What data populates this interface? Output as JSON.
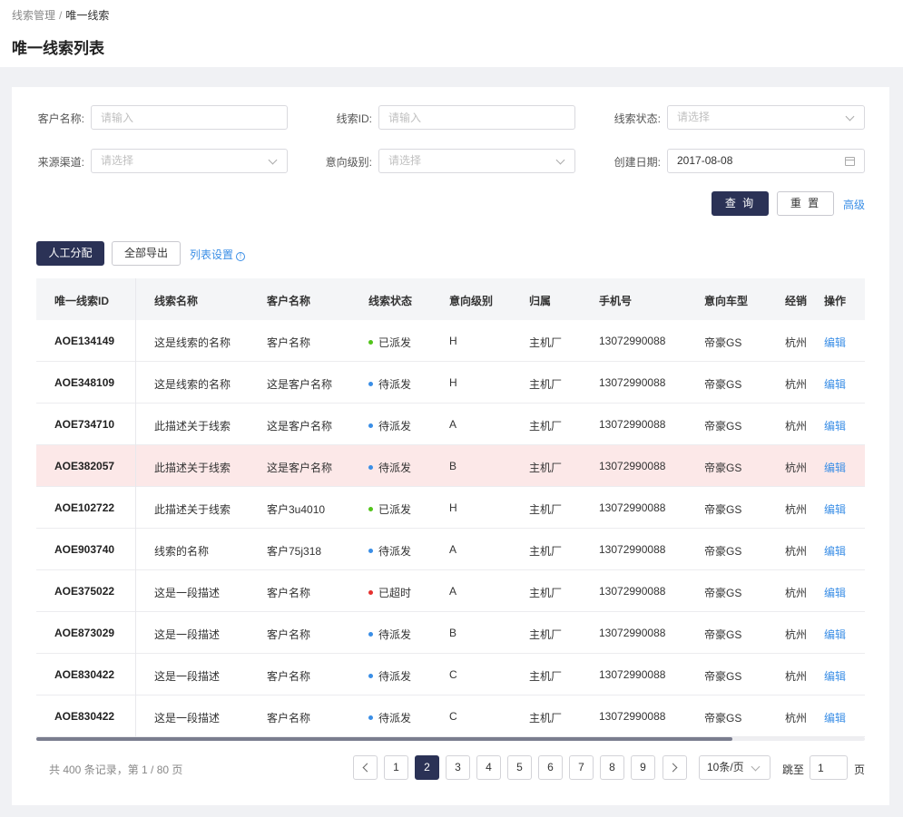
{
  "breadcrumb": {
    "parent": "线索管理",
    "separator": "/",
    "current": "唯一线索"
  },
  "page_title": "唯一线索列表",
  "filters": {
    "customer_name": {
      "label": "客户名称:",
      "placeholder": "请输入"
    },
    "lead_id": {
      "label": "线索ID:",
      "placeholder": "请输入"
    },
    "lead_status": {
      "label": "线索状态:",
      "placeholder": "请选择"
    },
    "source_channel": {
      "label": "来源渠道:",
      "placeholder": "请选择"
    },
    "intent_level": {
      "label": "意向级别:",
      "placeholder": "请选择"
    },
    "created_date": {
      "label": "创建日期:",
      "value": "2017-08-08"
    }
  },
  "actions": {
    "query": "查 询",
    "reset": "重 置",
    "advanced": "高级"
  },
  "toolbar": {
    "manual_assign": "人工分配",
    "export_all": "全部导出",
    "list_settings": "列表设置",
    "info_glyph": "!"
  },
  "table": {
    "columns": [
      "唯一线索ID",
      "线索名称",
      "客户名称",
      "线索状态",
      "意向级别",
      "归属",
      "手机号",
      "意向车型",
      "经销",
      "操作"
    ],
    "rows": [
      {
        "id": "AOE134149",
        "name": "这是线索的名称",
        "customer": "客户名称",
        "status": "已派发",
        "status_color": "#52c41a",
        "level": "H",
        "owner": "主机厂",
        "phone": "13072990088",
        "model": "帝豪GS",
        "dealer": "杭州",
        "action": "编辑"
      },
      {
        "id": "AOE348109",
        "name": "这是线索的名称",
        "customer": "这是客户名称",
        "status": "待派发",
        "status_color": "#3a8ee6",
        "level": "H",
        "owner": "主机厂",
        "phone": "13072990088",
        "model": "帝豪GS",
        "dealer": "杭州",
        "action": "编辑"
      },
      {
        "id": "AOE734710",
        "name": "此描述关于线索",
        "customer": "这是客户名称",
        "status": "待派发",
        "status_color": "#3a8ee6",
        "level": "A",
        "owner": "主机厂",
        "phone": "13072990088",
        "model": "帝豪GS",
        "dealer": "杭州",
        "action": "编辑"
      },
      {
        "id": "AOE382057",
        "name": "此描述关于线索",
        "customer": "这是客户名称",
        "status": "待派发",
        "status_color": "#3a8ee6",
        "level": "B",
        "owner": "主机厂",
        "phone": "13072990088",
        "model": "帝豪GS",
        "dealer": "杭州",
        "action": "编辑",
        "highlighted": true
      },
      {
        "id": "AOE102722",
        "name": "此描述关于线索",
        "customer": "客户3u4010",
        "status": "已派发",
        "status_color": "#52c41a",
        "level": "H",
        "owner": "主机厂",
        "phone": "13072990088",
        "model": "帝豪GS",
        "dealer": "杭州",
        "action": "编辑"
      },
      {
        "id": "AOE903740",
        "name": "线索的名称",
        "customer": "客户75j318",
        "status": "待派发",
        "status_color": "#3a8ee6",
        "level": "A",
        "owner": "主机厂",
        "phone": "13072990088",
        "model": "帝豪GS",
        "dealer": "杭州",
        "action": "编辑"
      },
      {
        "id": "AOE375022",
        "name": "这是一段描述",
        "customer": "客户名称",
        "status": "已超时",
        "status_color": "#e5312f",
        "level": "A",
        "owner": "主机厂",
        "phone": "13072990088",
        "model": "帝豪GS",
        "dealer": "杭州",
        "action": "编辑"
      },
      {
        "id": "AOE873029",
        "name": "这是一段描述",
        "customer": "客户名称",
        "status": "待派发",
        "status_color": "#3a8ee6",
        "level": "B",
        "owner": "主机厂",
        "phone": "13072990088",
        "model": "帝豪GS",
        "dealer": "杭州",
        "action": "编辑"
      },
      {
        "id": "AOE830422",
        "name": "这是一段描述",
        "customer": "客户名称",
        "status": "待派发",
        "status_color": "#3a8ee6",
        "level": "C",
        "owner": "主机厂",
        "phone": "13072990088",
        "model": "帝豪GS",
        "dealer": "杭州",
        "action": "编辑"
      },
      {
        "id": "AOE830422",
        "name": "这是一段描述",
        "customer": "客户名称",
        "status": "待派发",
        "status_color": "#3a8ee6",
        "level": "C",
        "owner": "主机厂",
        "phone": "13072990088",
        "model": "帝豪GS",
        "dealer": "杭州",
        "action": "编辑"
      }
    ]
  },
  "horizontal_scroll_fraction": 0.84,
  "pagination": {
    "summary": "共 400 条记录，第 1 / 80 页",
    "pages": [
      "1",
      "2",
      "3",
      "4",
      "5",
      "6",
      "7",
      "8",
      "9"
    ],
    "current_page": "2",
    "page_size": "10条/页",
    "jump_label": "跳至",
    "jump_value": "1",
    "page_unit": "页"
  },
  "colors": {
    "primary": "#2b3256",
    "link": "#3a8ee6",
    "highlight_row": "#fce8e8"
  }
}
